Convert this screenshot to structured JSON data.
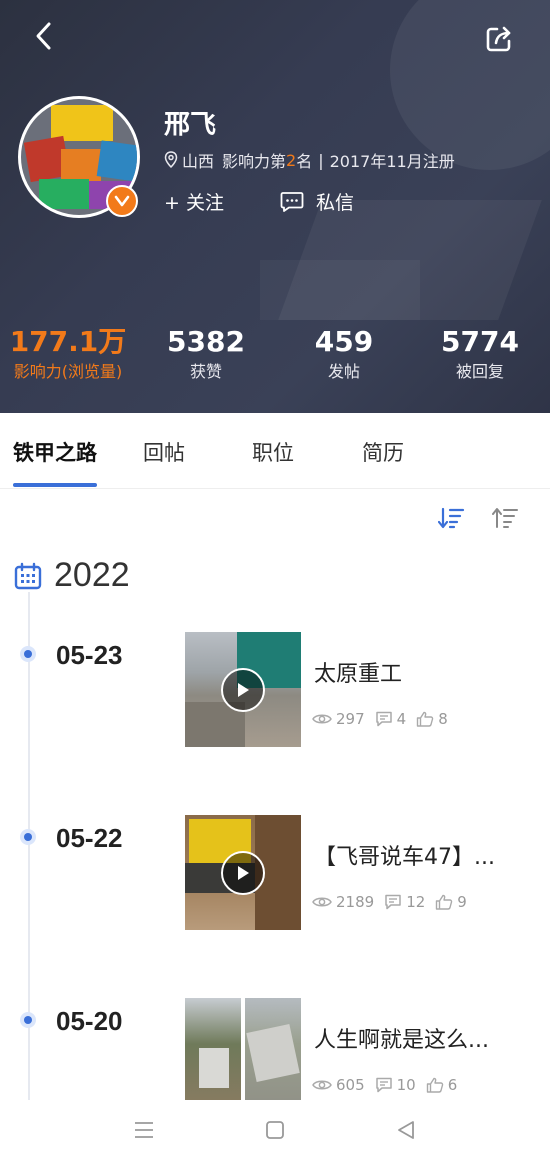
{
  "profile": {
    "name": "邢飞",
    "location": "山西",
    "influence_prefix": "影响力第",
    "influence_rank": "2",
    "influence_suffix": "名",
    "separator": "|",
    "registered": "2017年11月注册",
    "follow_label": "+ 关注",
    "message_label": "私信"
  },
  "stats": [
    {
      "value": "177.1万",
      "label": "影响力(浏览量)"
    },
    {
      "value": "5382",
      "label": "获赞"
    },
    {
      "value": "459",
      "label": "发帖"
    },
    {
      "value": "5774",
      "label": "被回复"
    }
  ],
  "tabs": [
    "铁甲之路",
    "回帖",
    "职位",
    "简历"
  ],
  "timeline": {
    "year": "2022",
    "entries": [
      {
        "date": "05-23",
        "title": "太原重工",
        "views": "297",
        "comments": "4",
        "likes": "8"
      },
      {
        "date": "05-22",
        "title": "【飞哥说车47】...",
        "views": "2189",
        "comments": "12",
        "likes": "9"
      },
      {
        "date": "05-20",
        "title": "人生啊就是这么...",
        "views": "605",
        "comments": "10",
        "likes": "6"
      }
    ]
  },
  "colors": {
    "accent_orange": "#f27a1a",
    "accent_blue": "#3a6fd8",
    "header_bg": "#343a4f"
  }
}
